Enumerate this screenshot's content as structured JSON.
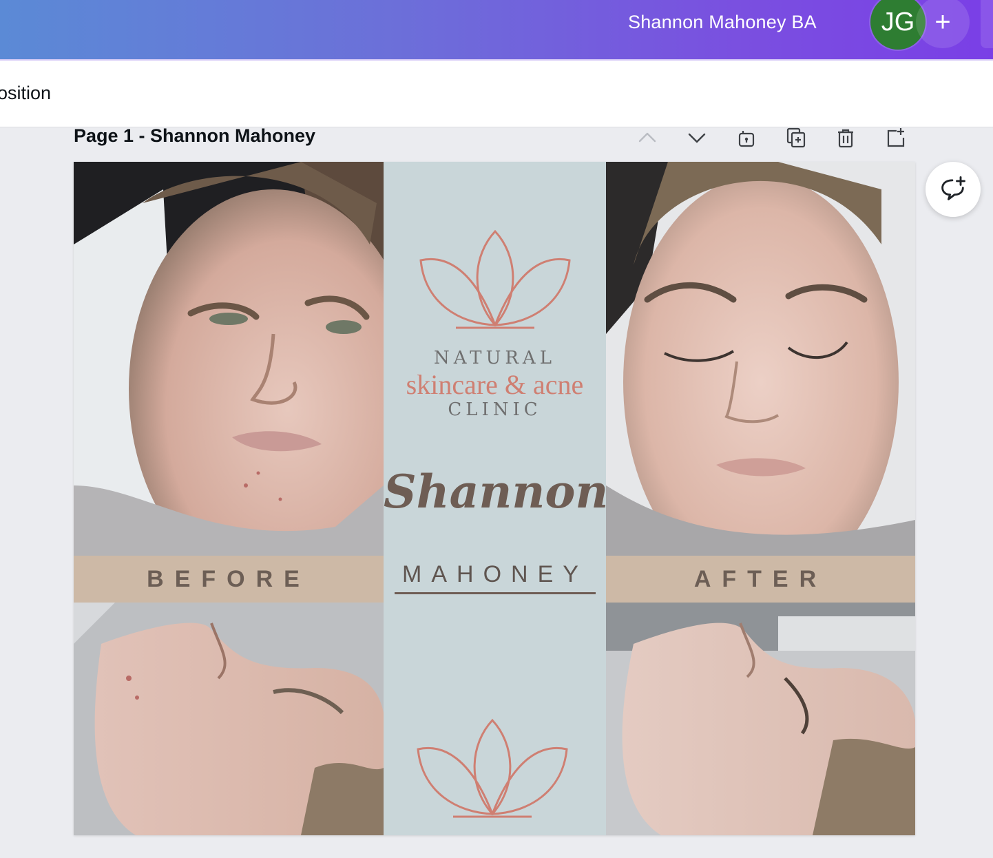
{
  "header": {
    "project_title": "Shannon Mahoney BA",
    "avatar_initials": "JG",
    "add_label": "+"
  },
  "toolbar": {
    "label": "osition"
  },
  "page": {
    "title": "Page 1 - Shannon Mahoney"
  },
  "design": {
    "before_label": "BEFORE",
    "after_label": "AFTER",
    "logo_line1": "NATURAL",
    "logo_line2": "skincare & acne",
    "logo_line3": "CLINIC",
    "name_script": "Shannon",
    "name_surname": "MAHONEY"
  },
  "colors": {
    "topbar_start": "#5b8ad6",
    "topbar_end": "#7a3fe6",
    "avatar": "#2e7d32",
    "canvas_bg": "#c9d6d9",
    "band": "#cdb9a6",
    "lotus": "#cf7f72"
  },
  "icons": {
    "page_actions": [
      "chevron-up-icon",
      "chevron-down-icon",
      "lock-icon",
      "duplicate-page-icon",
      "trash-icon",
      "add-page-icon"
    ],
    "comment": "add-comment-icon"
  }
}
